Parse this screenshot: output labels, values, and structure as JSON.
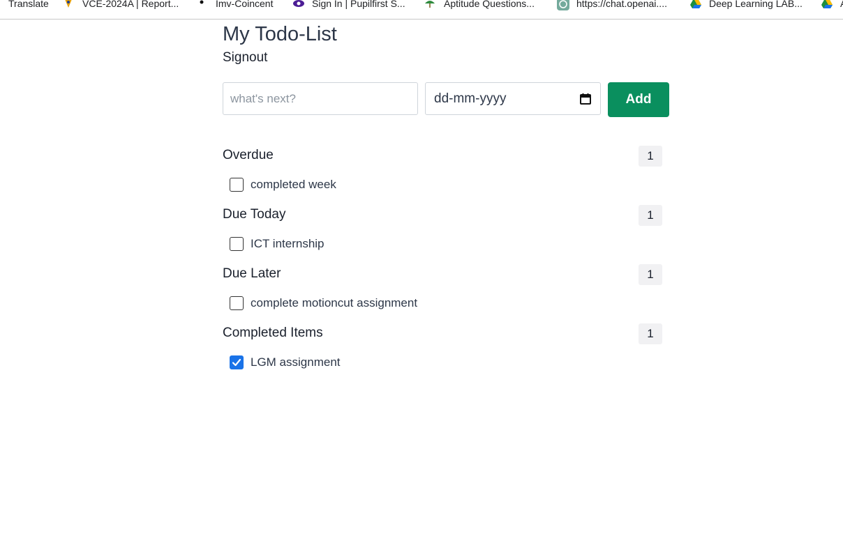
{
  "bookmarks": [
    {
      "label": "Translate",
      "icon": "translate-icon"
    },
    {
      "label": "VCE-2024A | Report...",
      "icon": "vce-logo-icon"
    },
    {
      "label": "Imv-Coincent",
      "icon": "dot-icon"
    },
    {
      "label": "Sign In | Pupilfirst S...",
      "icon": "pupilfirst-icon"
    },
    {
      "label": "Aptitude Questions...",
      "icon": "umbrella-icon"
    },
    {
      "label": "https://chat.openai....",
      "icon": "openai-icon"
    },
    {
      "label": "Deep Learning LAB...",
      "icon": "drive-icon"
    },
    {
      "label": "A",
      "icon": "drive-icon"
    }
  ],
  "page": {
    "title": "My Todo-List",
    "signout": "Signout"
  },
  "form": {
    "todo_placeholder": "what's next?",
    "todo_value": "",
    "date_placeholder": "dd-mm-yyyy",
    "add_label": "Add"
  },
  "sections": [
    {
      "title": "Overdue",
      "count": "1",
      "items": [
        {
          "label": "completed week",
          "checked": false
        }
      ]
    },
    {
      "title": "Due Today",
      "count": "1",
      "items": [
        {
          "label": "ICT internship",
          "checked": false
        }
      ]
    },
    {
      "title": "Due Later",
      "count": "1",
      "items": [
        {
          "label": "complete motioncut assignment",
          "checked": false
        }
      ]
    },
    {
      "title": "Completed Items",
      "count": "1",
      "items": [
        {
          "label": "LGM assignment",
          "checked": true
        }
      ]
    }
  ],
  "colors": {
    "add_button": "#0a8f5e",
    "checkbox_checked": "#1a73e8",
    "badge_bg": "#f1f1f3"
  }
}
